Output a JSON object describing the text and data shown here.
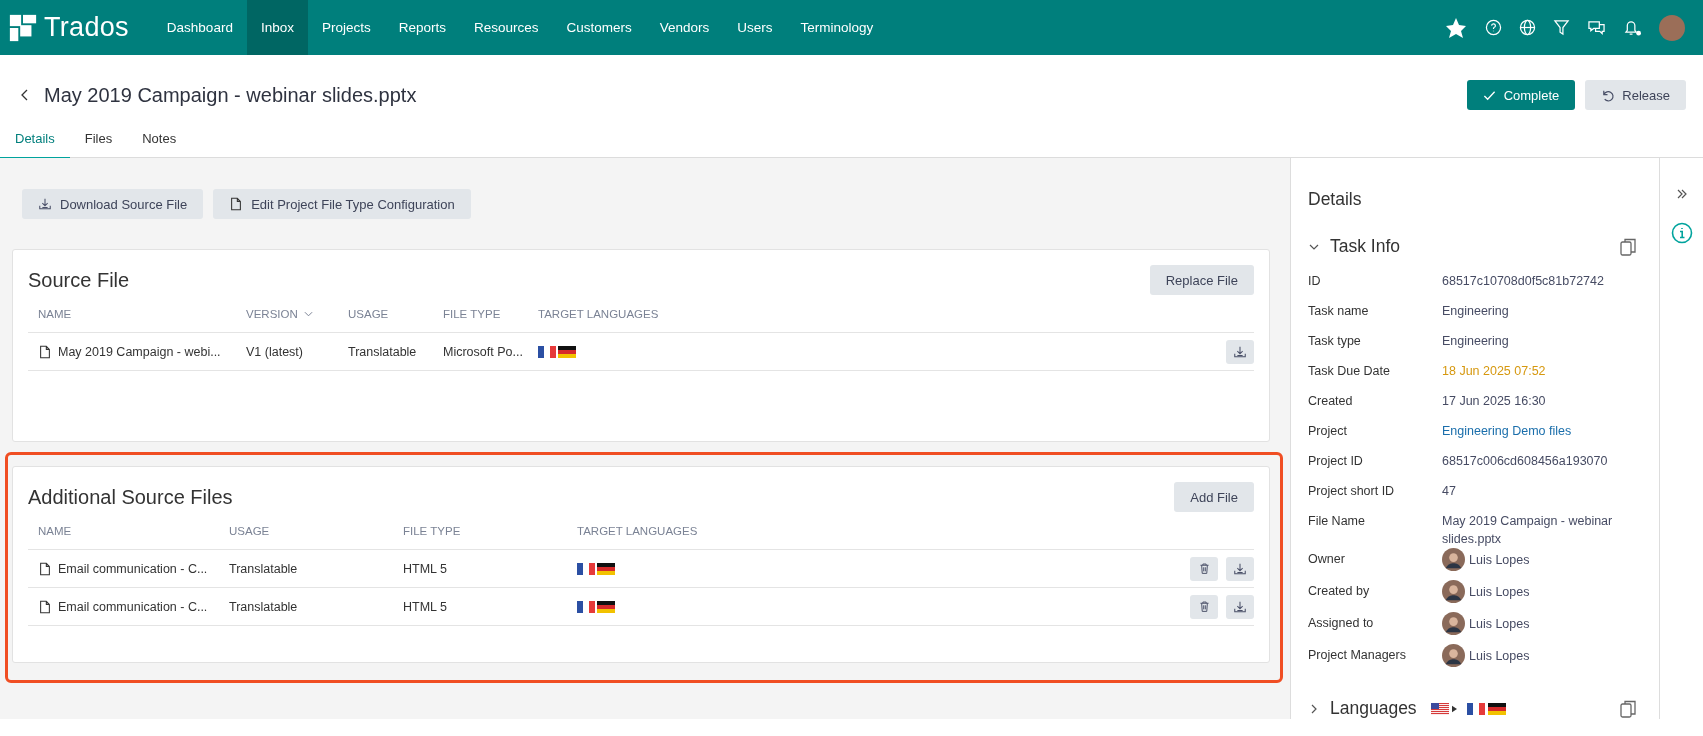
{
  "topbar": {
    "logo": "Trados",
    "nav": [
      {
        "label": "Dashboard",
        "selected": false
      },
      {
        "label": "Inbox",
        "selected": true
      },
      {
        "label": "Projects",
        "selected": false
      },
      {
        "label": "Reports",
        "selected": false
      },
      {
        "label": "Resources",
        "selected": false
      },
      {
        "label": "Customers",
        "selected": false
      },
      {
        "label": "Vendors",
        "selected": false
      },
      {
        "label": "Users",
        "selected": false
      },
      {
        "label": "Terminology",
        "selected": false
      }
    ],
    "notifications_unread": true
  },
  "header": {
    "title": "May 2019 Campaign - webinar slides.pptx",
    "buttons": [
      {
        "label": "Complete",
        "kind": "primary"
      },
      {
        "label": "Release",
        "kind": "secondary"
      }
    ]
  },
  "tabs": [
    {
      "label": "Details",
      "selected": true
    },
    {
      "label": "Files",
      "selected": false
    },
    {
      "label": "Notes",
      "selected": false
    }
  ],
  "toolbar": [
    {
      "label": "Download Source File",
      "kind": "download"
    },
    {
      "label": "Edit Project File Type Configuration",
      "kind": "file"
    }
  ],
  "source_file": {
    "title": "Source File",
    "action": "Replace File",
    "columns": [
      {
        "label": "NAME",
        "sortable": false
      },
      {
        "label": "VERSION",
        "sortable": true
      },
      {
        "label": "USAGE",
        "sortable": false
      },
      {
        "label": "FILE TYPE",
        "sortable": false
      },
      {
        "label": "TARGET LANGUAGES",
        "sortable": false
      }
    ],
    "rows": [
      {
        "name": "May 2019 Campaign - webi...",
        "version": "V1 (latest)",
        "usage": "Translatable",
        "file_type": "Microsoft Po...",
        "target_languages": [
          {
            "kind": "fr"
          },
          {
            "kind": "de"
          }
        ]
      }
    ]
  },
  "additional_source_files": {
    "title": "Additional Source Files",
    "highlighted": true,
    "action": "Add File",
    "columns": [
      {
        "label": "NAME"
      },
      {
        "label": "USAGE"
      },
      {
        "label": "FILE TYPE"
      },
      {
        "label": "TARGET LANGUAGES"
      }
    ],
    "rows": [
      {
        "name": "Email communication - C...",
        "usage": "Translatable",
        "file_type": "HTML 5",
        "target_languages": [
          {
            "kind": "fr"
          },
          {
            "kind": "de"
          }
        ]
      },
      {
        "name": "Email communication - C...",
        "usage": "Translatable",
        "file_type": "HTML 5",
        "target_languages": [
          {
            "kind": "fr"
          },
          {
            "kind": "de"
          }
        ]
      }
    ]
  },
  "details_panel": {
    "title": "Details",
    "task_info": {
      "title": "Task Info",
      "expanded": true,
      "fields": [
        {
          "label": "ID",
          "value": "68517c10708d0f5c81b72742",
          "kind": "text"
        },
        {
          "label": "Task name",
          "value": "Engineering",
          "kind": "text"
        },
        {
          "label": "Task type",
          "value": "Engineering",
          "kind": "text"
        },
        {
          "label": "Task Due Date",
          "value": "18 Jun 2025 07:52",
          "kind": "warning"
        },
        {
          "label": "Created",
          "value": "17 Jun 2025 16:30",
          "kind": "text"
        },
        {
          "label": "Project",
          "value": "Engineering Demo files",
          "kind": "link"
        },
        {
          "label": "Project ID",
          "value": "68517c006cd608456a193070",
          "kind": "text"
        },
        {
          "label": "Project short ID",
          "value": "47",
          "kind": "text"
        },
        {
          "label": "File Name",
          "value": "May 2019 Campaign - webinar slides.pptx",
          "kind": "text"
        },
        {
          "label": "Owner",
          "value": "Luis Lopes",
          "kind": "person"
        },
        {
          "label": "Created by",
          "value": "Luis Lopes",
          "kind": "person"
        },
        {
          "label": "Assigned to",
          "value": "Luis Lopes",
          "kind": "person"
        },
        {
          "label": "Project Managers",
          "value": "Luis Lopes",
          "kind": "person"
        }
      ]
    },
    "languages": {
      "title": "Languages",
      "expanded": false,
      "source": {
        "kind": "us"
      },
      "targets": [
        {
          "kind": "fr"
        },
        {
          "kind": "de"
        }
      ]
    }
  }
}
